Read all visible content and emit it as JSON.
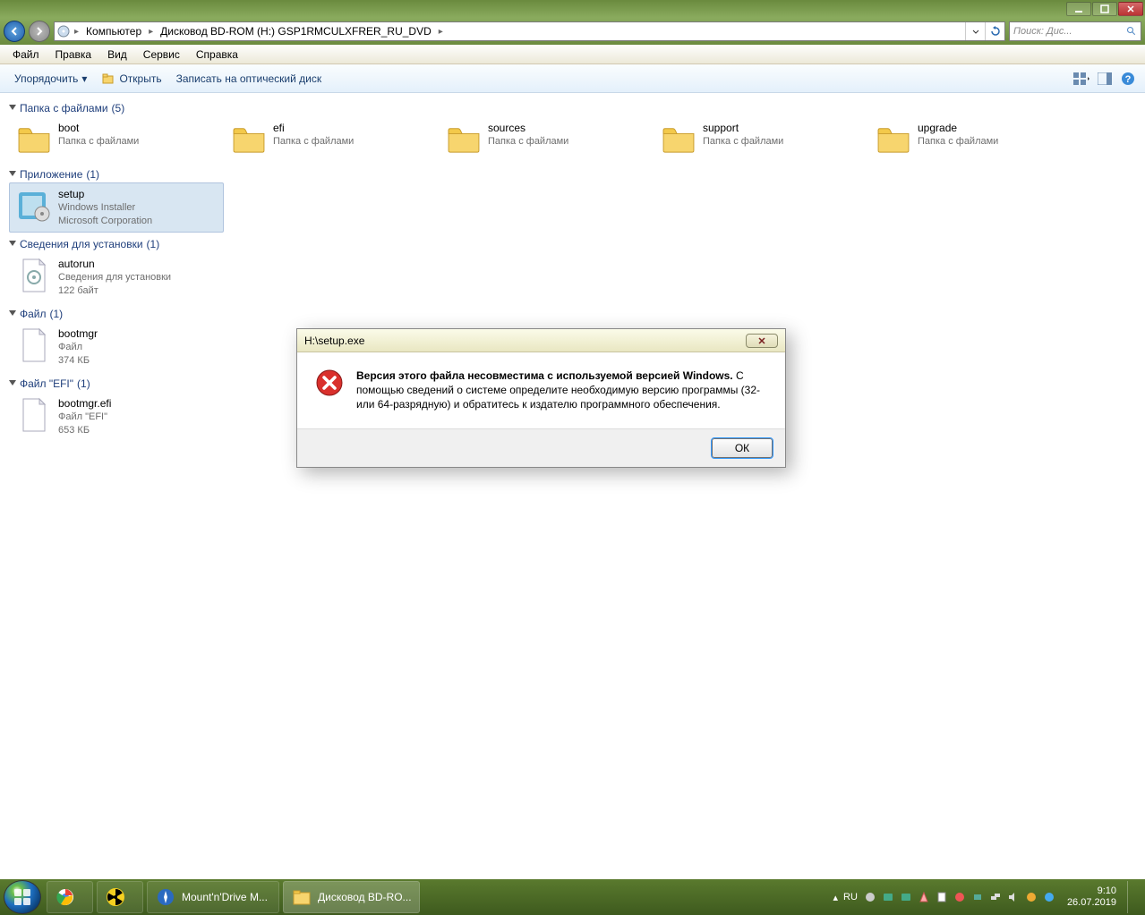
{
  "window": {
    "breadcrumb": [
      "Компьютер",
      "Дисковод BD-ROM (H:) GSP1RMCULXFRER_RU_DVD"
    ],
    "search_placeholder": "Поиск: Дис..."
  },
  "menubar": [
    "Файл",
    "Правка",
    "Вид",
    "Сервис",
    "Справка"
  ],
  "toolbar": {
    "organize": "Упорядочить",
    "open": "Открыть",
    "burn": "Записать на оптический диск"
  },
  "groups": [
    {
      "title": "Папка с файлами",
      "count": "(5)",
      "type": "folders",
      "items": [
        {
          "name": "boot",
          "sub": "Папка с файлами"
        },
        {
          "name": "efi",
          "sub": "Папка с файлами"
        },
        {
          "name": "sources",
          "sub": "Папка с файлами"
        },
        {
          "name": "support",
          "sub": "Папка с файлами"
        },
        {
          "name": "upgrade",
          "sub": "Папка с файлами"
        }
      ]
    },
    {
      "title": "Приложение",
      "count": "(1)",
      "type": "apps",
      "items": [
        {
          "name": "setup",
          "sub1": "Windows Installer",
          "sub2": "Microsoft Corporation",
          "selected": true
        }
      ]
    },
    {
      "title": "Сведения для установки",
      "count": "(1)",
      "type": "inf",
      "items": [
        {
          "name": "autorun",
          "sub1": "Сведения для установки",
          "sub2": "122 байт"
        }
      ]
    },
    {
      "title": "Файл",
      "count": "(1)",
      "type": "file",
      "items": [
        {
          "name": "bootmgr",
          "sub1": "Файл",
          "sub2": "374 КБ"
        }
      ]
    },
    {
      "title": "Файл \"EFI\"",
      "count": "(1)",
      "type": "file",
      "items": [
        {
          "name": "bootmgr.efi",
          "sub1": "Файл \"EFI\"",
          "sub2": "653 КБ"
        }
      ]
    }
  ],
  "dialog": {
    "title": "H:\\setup.exe",
    "message_bold": "Версия этого файла несовместима с используемой версией Windows.",
    "message_rest": " С помощью сведений о системе определите необходимую версию программы (32- или 64-разрядную) и обратитесь к издателю программного обеспечения.",
    "ok": "ОК"
  },
  "taskbar": {
    "tasks": [
      {
        "label": "",
        "icon": "chrome"
      },
      {
        "label": "",
        "icon": "radiation"
      },
      {
        "label": "Mount'n'Drive M...",
        "icon": "daemon"
      },
      {
        "label": "Дисковод BD-RO...",
        "icon": "explorer",
        "active": true
      }
    ],
    "lang": "RU",
    "time": "9:10",
    "date": "26.07.2019"
  }
}
